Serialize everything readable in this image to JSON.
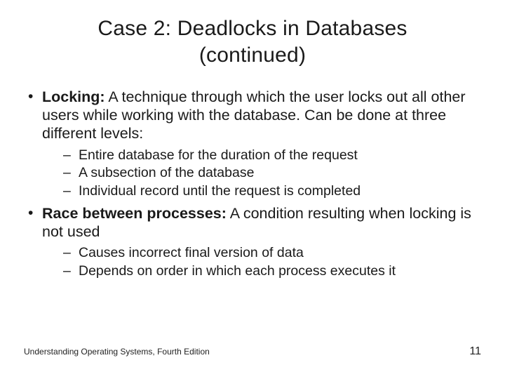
{
  "title": {
    "line1": "Case 2: Deadlocks in Databases",
    "line2": "(continued)"
  },
  "bullets": {
    "locking": {
      "term": "Locking:",
      "text": " A technique through which the user locks out all other users while working with the database. Can be done at three different levels:",
      "sub": [
        "Entire database for the duration of the request",
        "A subsection of the database",
        "Individual record until the request is completed"
      ]
    },
    "race": {
      "term": "Race between processes:",
      "text": "  A condition resulting when locking is not used",
      "sub": [
        "Causes incorrect final version of data",
        "Depends on order in which each process executes it"
      ]
    }
  },
  "footer": {
    "text": "Understanding Operating Systems, Fourth Edition",
    "page": "11"
  }
}
